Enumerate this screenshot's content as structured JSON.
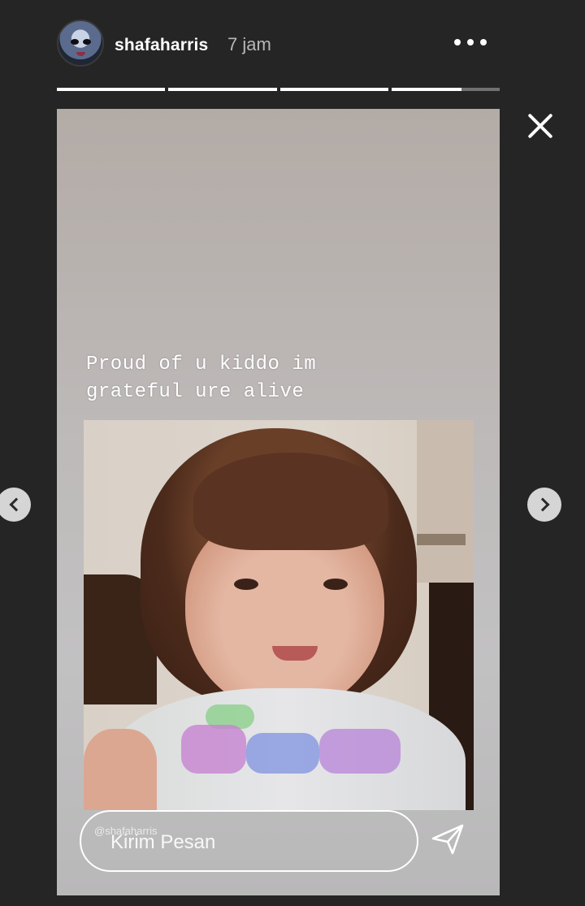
{
  "header": {
    "username": "shafaharris",
    "time_ago": "7 jam"
  },
  "progress": {
    "segments": [
      1,
      1,
      1,
      0.65
    ]
  },
  "story": {
    "caption_lines": [
      "Proud of u kiddo im",
      "grateful ure alive"
    ],
    "handle_watermark": "@shafaharris"
  },
  "reply": {
    "placeholder": "Kirim Pesan"
  },
  "icons": {
    "more": "more-horizontal-icon",
    "close": "close-icon",
    "prev": "chevron-left-icon",
    "next": "chevron-right-icon",
    "send": "send-icon"
  },
  "colors": {
    "background": "#252525",
    "text_primary": "#ffffff",
    "text_secondary": "#b7b7b7"
  }
}
